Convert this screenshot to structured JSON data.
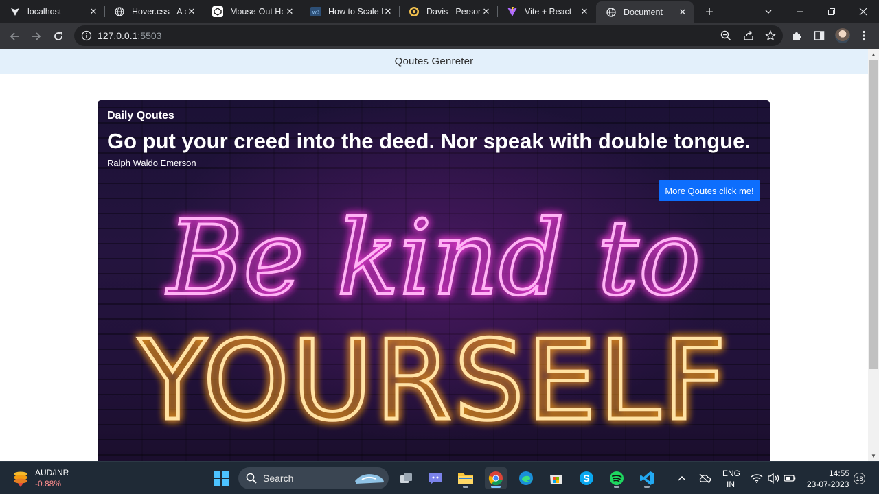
{
  "browser": {
    "tabs": [
      {
        "title": "localhost",
        "icon": "vite-logo-icon"
      },
      {
        "title": "Hover.css - A c",
        "icon": "globe-icon"
      },
      {
        "title": "Mouse-Out Ho",
        "icon": "codepen-icon"
      },
      {
        "title": "How to Scale Ir",
        "icon": "w3schools-icon"
      },
      {
        "title": "Davis - Persona",
        "icon": "portfolio-icon"
      },
      {
        "title": "Vite + React",
        "icon": "vite-logo-icon"
      },
      {
        "title": "Document",
        "icon": "globe-icon",
        "active": true
      }
    ],
    "address": {
      "host": "127.0.0.1",
      "port": ":5503"
    }
  },
  "page": {
    "navbar_title": "Qoutes Genreter",
    "card": {
      "title": "Daily Qoutes",
      "quote": "Go put your creed into the deed. Nor speak with double tongue.",
      "author": "Ralph Waldo Emerson",
      "button_label": "More Qoutes click me!",
      "image_text_line1": "Be kind to",
      "image_text_line2": "YOURSELF"
    }
  },
  "taskbar": {
    "widget": {
      "name": "AUD/INR",
      "value": "-0.88%"
    },
    "search_label": "Search",
    "lang_line1": "ENG",
    "lang_line2": "IN",
    "time": "14:55",
    "date": "23-07-2023",
    "notifications": "18"
  },
  "colors": {
    "navbar_bg": "#e3f0fb",
    "button_bg": "#0d6efd",
    "neon_pink": "#ff3fe0",
    "neon_orange": "#ffa11a",
    "widget_negative": "#ff8e8e"
  }
}
